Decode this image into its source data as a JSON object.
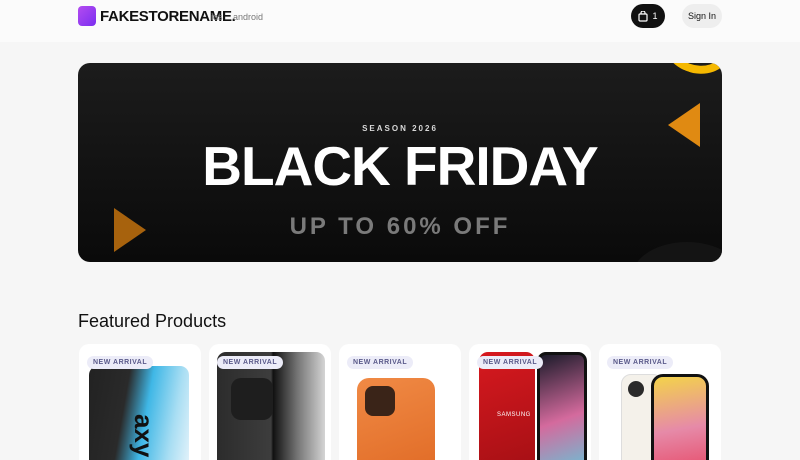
{
  "nav": {
    "brand": "FAKESTORENAME.",
    "links": [
      "ios",
      "android"
    ],
    "cart_count": "1",
    "signin_label": "Sign In",
    "icons": {
      "logo": "purple-square-logo",
      "cart": "shopping-bag-icon"
    }
  },
  "hero": {
    "season": "SEASON 2026",
    "title": "BLACK FRIDAY",
    "subtitle": "UP TO 60% OFF",
    "colors": {
      "background": "#111111",
      "accent": "#e08a12",
      "arc": "#f5b800"
    }
  },
  "featured": {
    "title": "Featured Products",
    "products": [
      {
        "badge": "NEW ARRIVAL"
      },
      {
        "badge": "NEW ARRIVAL"
      },
      {
        "badge": "NEW ARRIVAL"
      },
      {
        "badge": "NEW ARRIVAL"
      },
      {
        "badge": "NEW ARRIVAL"
      }
    ]
  }
}
